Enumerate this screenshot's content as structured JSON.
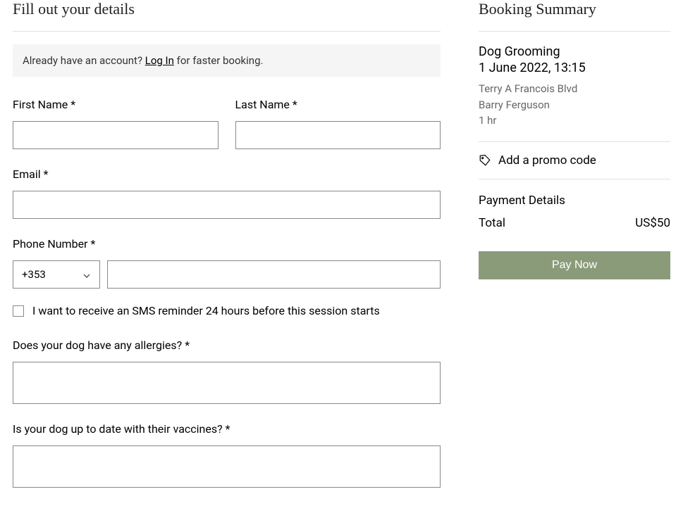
{
  "form": {
    "title": "Fill out your details",
    "login_prompt_before": "Already have an account? ",
    "login_link": "Log In",
    "login_prompt_after": " for faster booking.",
    "first_name_label": "First Name *",
    "last_name_label": "Last Name *",
    "email_label": "Email *",
    "phone_label": "Phone Number *",
    "phone_code": "+353",
    "sms_checkbox_label": "I want to receive an SMS reminder 24 hours before this session starts",
    "allergies_label": "Does your dog have any allergies? *",
    "vaccines_label": "Is your dog up to date with their vaccines? *"
  },
  "summary": {
    "title": "Booking Summary",
    "service": "Dog Grooming",
    "datetime": "1 June 2022, 13:15",
    "location": "Terry A Francois Blvd",
    "staff": "Barry Ferguson",
    "duration": "1 hr",
    "promo_label": "Add a promo code",
    "payment_title": "Payment Details",
    "total_label": "Total",
    "total_amount": "US$50",
    "pay_button": "Pay Now"
  }
}
